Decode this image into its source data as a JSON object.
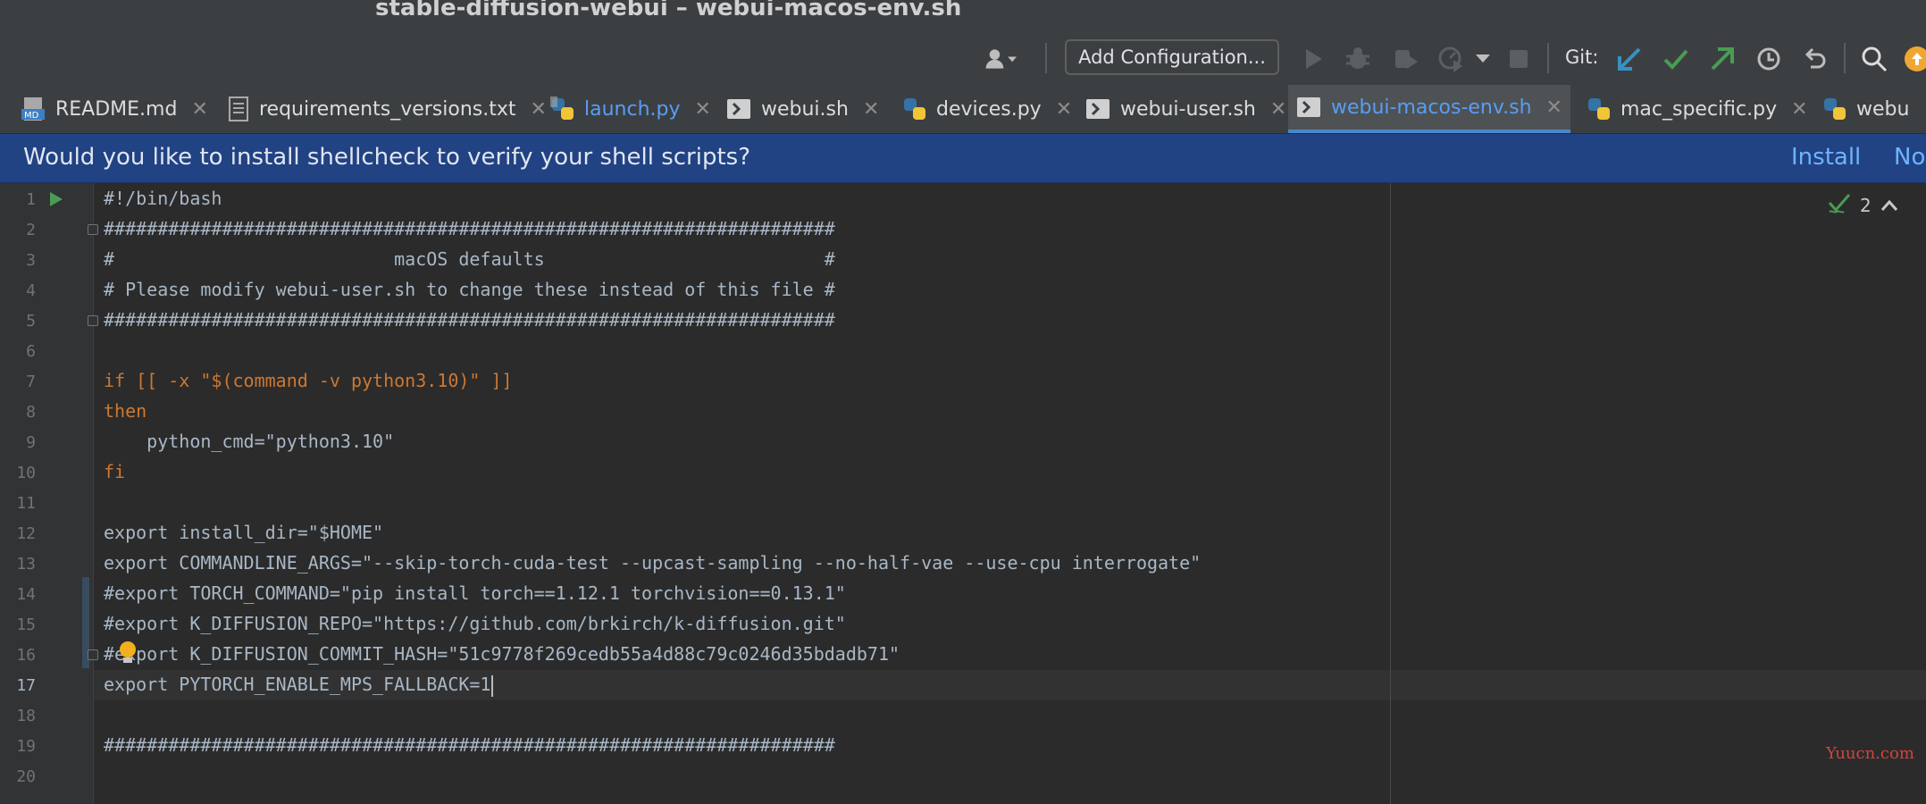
{
  "window": {
    "title": "stable-diffusion-webui – webui-macos-env.sh"
  },
  "toolbar": {
    "add_configuration": "Add Configuration...",
    "git_label": "Git:",
    "icons": [
      "user-icon",
      "run-icon",
      "debug-icon",
      "coverage-icon",
      "profile-icon",
      "stop-icon",
      "git-update-icon",
      "git-commit-icon",
      "git-push-icon",
      "history-icon",
      "revert-icon",
      "search-icon",
      "update-icon"
    ]
  },
  "tabs": [
    {
      "label": "README.md",
      "icon": "markdown-file-icon",
      "active": false
    },
    {
      "label": "requirements_versions.txt",
      "icon": "text-file-icon",
      "active": false
    },
    {
      "label": "launch.py",
      "icon": "python-file-icon",
      "active": false
    },
    {
      "label": "webui.sh",
      "icon": "shell-file-icon",
      "active": false
    },
    {
      "label": "devices.py",
      "icon": "python-file-icon",
      "active": false
    },
    {
      "label": "webui-user.sh",
      "icon": "shell-file-icon",
      "active": false
    },
    {
      "label": "webui-macos-env.sh",
      "icon": "shell-file-icon",
      "active": true
    },
    {
      "label": "mac_specific.py",
      "icon": "python-file-icon",
      "active": false
    },
    {
      "label": "webu",
      "icon": "python-file-icon",
      "active": false
    }
  ],
  "notification": {
    "text": "Would you like to install shellcheck to verify your shell scripts?",
    "install": "Install",
    "no": "No"
  },
  "editor": {
    "inspection_count": "2",
    "line_numbers": [
      "1",
      "2",
      "3",
      "4",
      "5",
      "6",
      "7",
      "8",
      "9",
      "10",
      "11",
      "12",
      "13",
      "14",
      "15",
      "16",
      "17",
      "18",
      "19",
      "20"
    ],
    "current_line": 17,
    "lines": [
      "#!/bin/bash",
      "####################################################################",
      "#                          macOS defaults                          #",
      "# Please modify webui-user.sh to change these instead of this file #",
      "####################################################################",
      "",
      "if [[ -x \"$(command -v python3.10)\" ]]",
      "then",
      "    python_cmd=\"python3.10\"",
      "fi",
      "",
      "export install_dir=\"$HOME\"",
      "export COMMANDLINE_ARGS=\"--skip-torch-cuda-test --upcast-sampling --no-half-vae --use-cpu interrogate\"",
      "#export TORCH_COMMAND=\"pip install torch==1.12.1 torchvision==0.13.1\"",
      "#export K_DIFFUSION_REPO=\"https://github.com/brkirch/k-diffusion.git\"",
      "#export K_DIFFUSION_COMMIT_HASH=\"51c9778f269cedb55a4d88c79c0246d35bdadb71\"",
      "export PYTORCH_ENABLE_MPS_FALLBACK=1",
      "",
      "####################################################################",
      ""
    ]
  },
  "watermark": "Yuucn.com",
  "colors": {
    "accent": "#4a88c7",
    "notification_bg": "#214283",
    "keyword": "#cc7832",
    "string": "#6a8759"
  }
}
